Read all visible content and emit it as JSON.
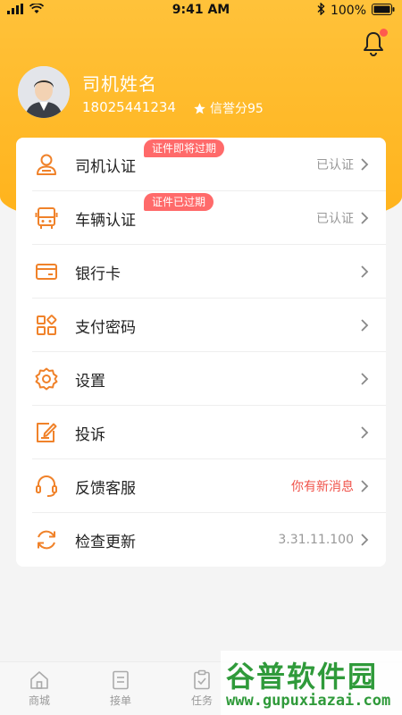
{
  "status_bar": {
    "time": "9:41 AM",
    "battery": "100%"
  },
  "profile": {
    "name": "司机姓名",
    "phone": "18025441234",
    "credit": "信誉分95"
  },
  "menu": [
    {
      "label": "司机认证",
      "value": "已认证",
      "badge": "证件即将过期",
      "icon": "user-icon"
    },
    {
      "label": "车辆认证",
      "value": "已认证",
      "badge": "证件已过期",
      "icon": "bus-icon"
    },
    {
      "label": "银行卡",
      "value": "",
      "icon": "card-icon"
    },
    {
      "label": "支付密码",
      "value": "",
      "icon": "grid-icon"
    },
    {
      "label": "设置",
      "value": "",
      "icon": "gear-icon"
    },
    {
      "label": "投诉",
      "value": "",
      "icon": "edit-icon"
    },
    {
      "label": "反馈客服",
      "value": "你有新消息",
      "icon": "headset-icon"
    },
    {
      "label": "检查更新",
      "value": "3.31.11.100",
      "icon": "refresh-icon"
    }
  ],
  "tabbar": [
    {
      "label": "商城",
      "icon": "home-icon"
    },
    {
      "label": "接单",
      "icon": "list-icon"
    },
    {
      "label": "任务",
      "icon": "task-icon"
    }
  ],
  "watermark": {
    "main": "谷普软件园",
    "sub": "www.gupuxiazai.com"
  },
  "colors": {
    "accent": "#ffb21a",
    "icon": "#f0822a",
    "alert": "#f0524a",
    "badge": "#ff6a6a"
  }
}
